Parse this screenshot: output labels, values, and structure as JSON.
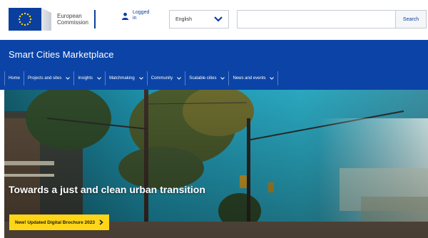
{
  "header": {
    "logo_line1": "European",
    "logo_line2": "Commission",
    "login_label": "Logged in",
    "language_selected": "English",
    "search_value": "",
    "search_button": "Search"
  },
  "site": {
    "title": "Smart Cities Marketplace"
  },
  "nav": {
    "items": [
      {
        "label": "Home",
        "dropdown": false
      },
      {
        "label": "Projects and sites",
        "dropdown": true
      },
      {
        "label": "Insights",
        "dropdown": true
      },
      {
        "label": "Matchmaking",
        "dropdown": true
      },
      {
        "label": "Community",
        "dropdown": true
      },
      {
        "label": "Scalable cities",
        "dropdown": true
      },
      {
        "label": "News and events",
        "dropdown": true
      }
    ]
  },
  "hero": {
    "heading": "Towards a just and clean urban transition",
    "cta_label": "New! Updated Digital Brochure 2023"
  },
  "colors": {
    "brand_blue": "#0b44a6",
    "cta_yellow": "#ffd617"
  },
  "icons": {
    "login": "user-icon",
    "language_caret": "chevron-down-icon",
    "nav_caret": "chevron-down-icon",
    "cta_arrow": "chevron-right-icon"
  }
}
